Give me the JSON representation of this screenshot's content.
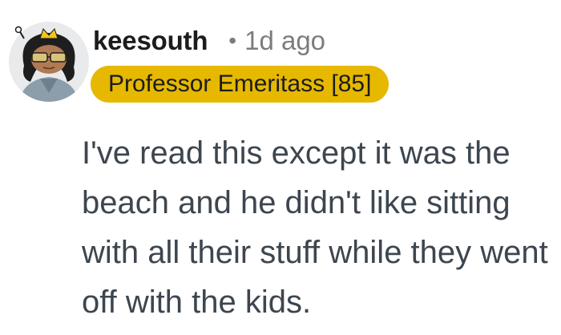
{
  "comment": {
    "username": "keesouth",
    "separator": "•",
    "time": "1d ago",
    "flair": "Professor Emeritass [85]",
    "text": "I've read this except it was the beach and he didn't like sitting with all their stuff while they went off with the kids."
  },
  "colors": {
    "flair_bg": "#e6b800",
    "username": "#1c1c1c",
    "meta": "#7c7c7c",
    "body": "#3d464f"
  },
  "icons": {
    "avatar": "snoo-avatar-icon"
  }
}
